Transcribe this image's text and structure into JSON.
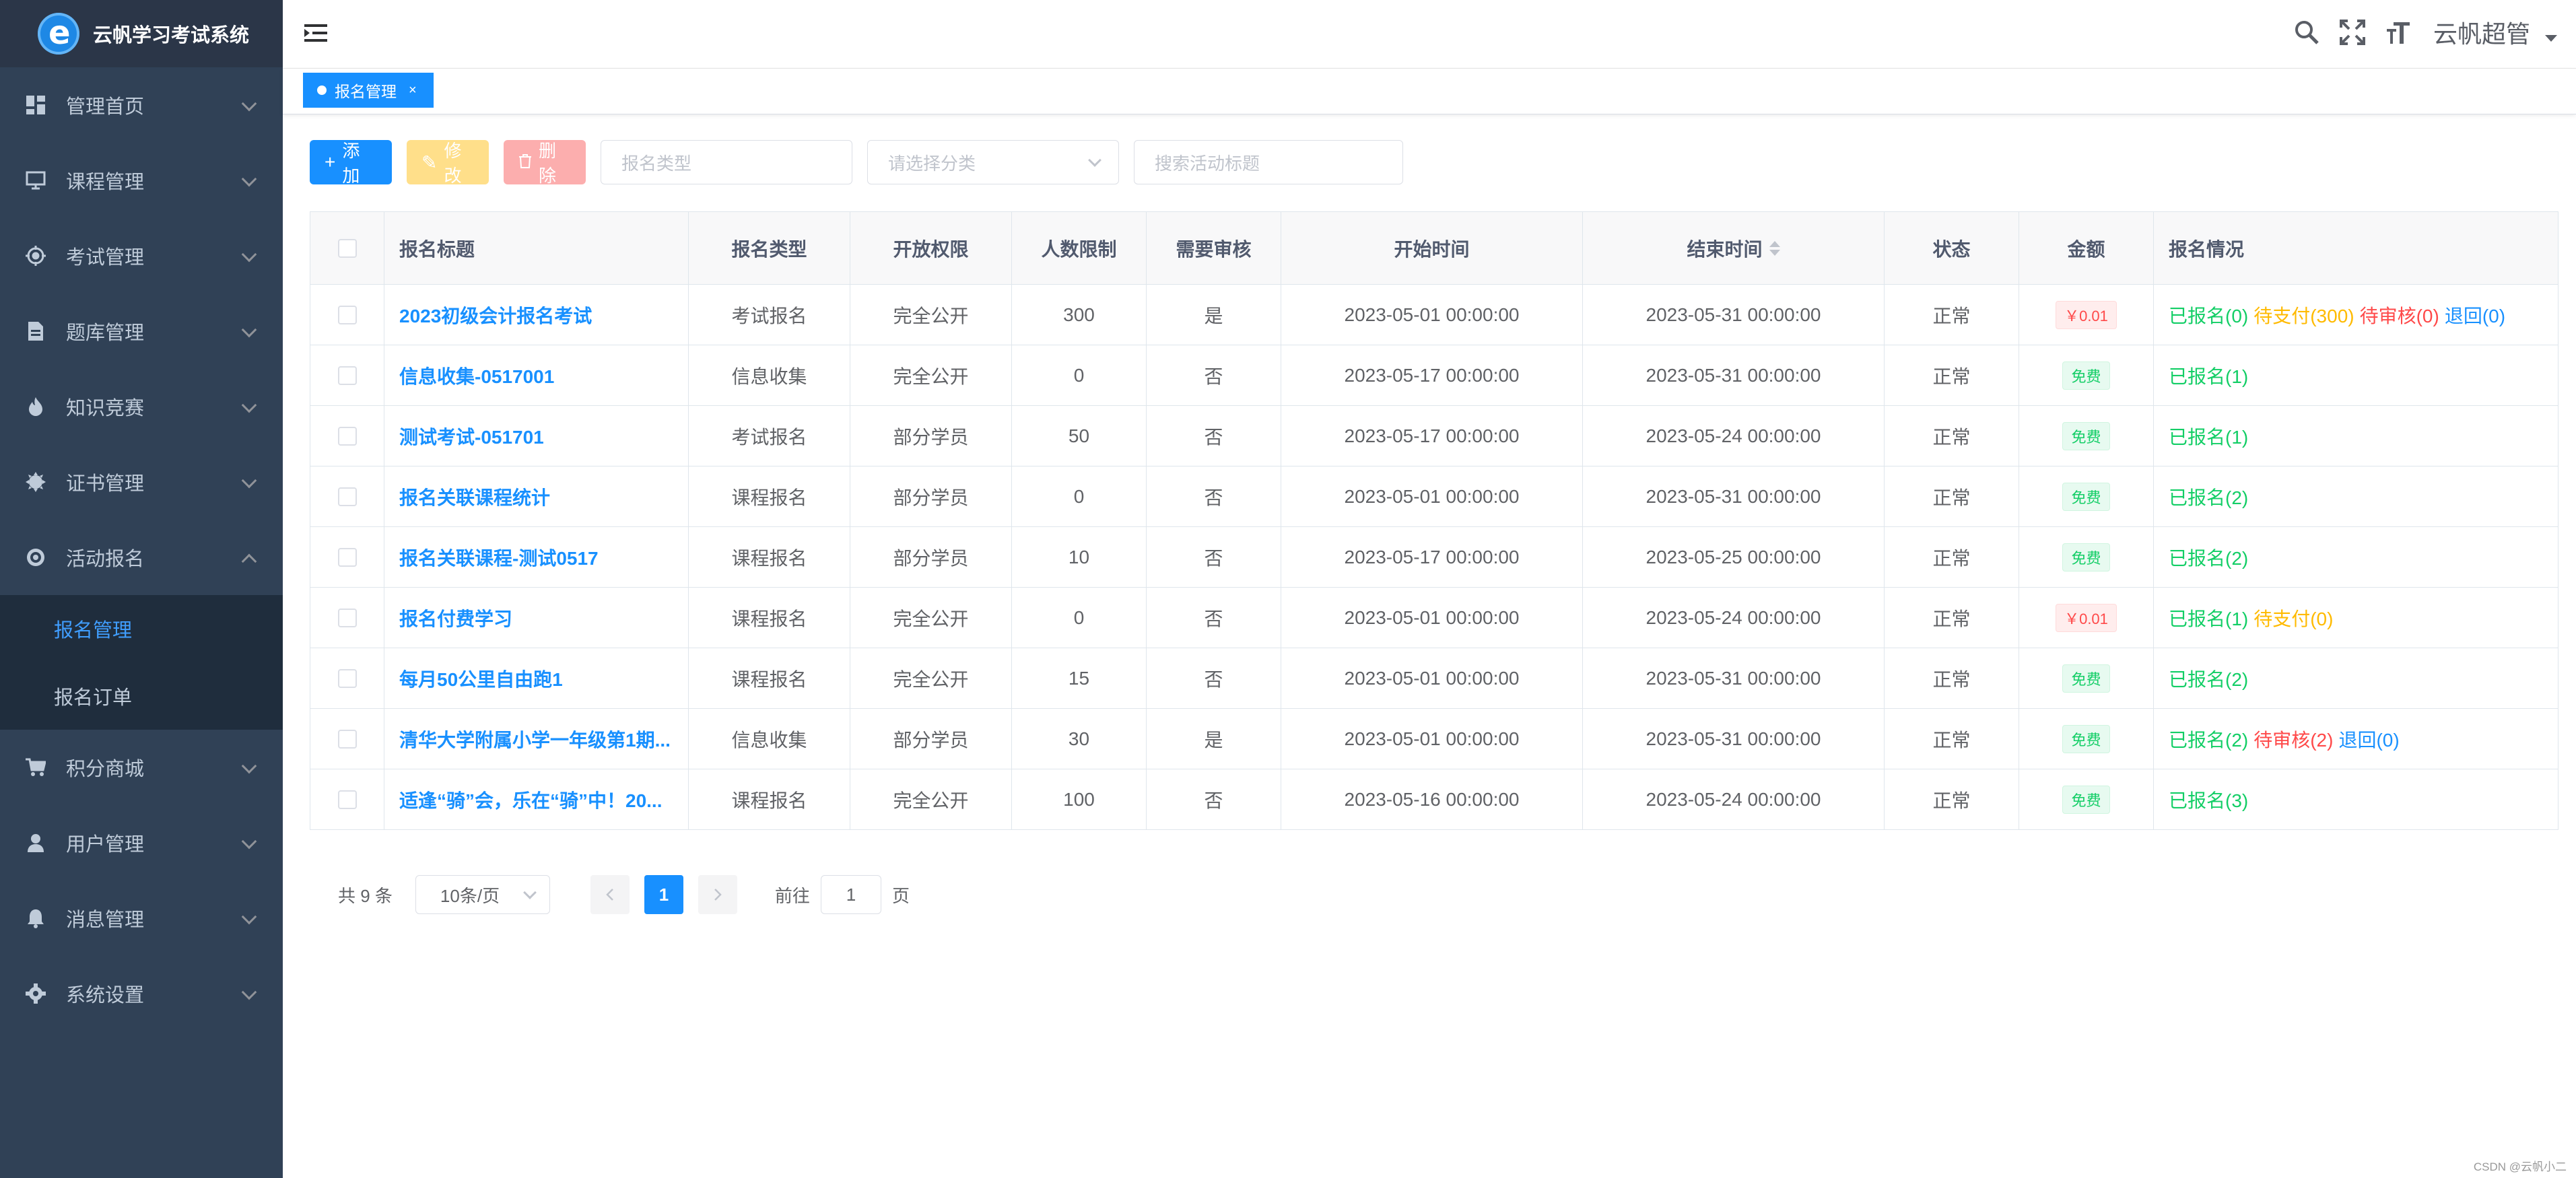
{
  "app": {
    "title": "云帆学习考试系统"
  },
  "sidebar": {
    "items": [
      {
        "label": "管理首页",
        "icon": "dashboard-icon"
      },
      {
        "label": "课程管理",
        "icon": "monitor-icon"
      },
      {
        "label": "考试管理",
        "icon": "target-icon"
      },
      {
        "label": "题库管理",
        "icon": "document-icon"
      },
      {
        "label": "知识竞赛",
        "icon": "fire-icon"
      },
      {
        "label": "证书管理",
        "icon": "badge-icon"
      },
      {
        "label": "活动报名",
        "icon": "record-icon",
        "expanded": true,
        "children": [
          {
            "label": "报名管理",
            "active": true
          },
          {
            "label": "报名订单"
          }
        ]
      },
      {
        "label": "积分商城",
        "icon": "cart-icon"
      },
      {
        "label": "用户管理",
        "icon": "user-icon"
      },
      {
        "label": "消息管理",
        "icon": "bell-icon"
      },
      {
        "label": "系统设置",
        "icon": "gear-icon"
      }
    ]
  },
  "header": {
    "username": "云帆超管"
  },
  "tags": [
    {
      "label": "报名管理",
      "close": "×"
    }
  ],
  "toolbar": {
    "add_label": "添加",
    "edit_label": "修改",
    "delete_label": "删除",
    "type_placeholder": "报名类型",
    "category_placeholder": "请选择分类",
    "search_placeholder": "搜索活动标题"
  },
  "table": {
    "columns": [
      "报名标题",
      "报名类型",
      "开放权限",
      "人数限制",
      "需要审核",
      "开始时间",
      "结束时间",
      "状态",
      "金额",
      "报名情况"
    ],
    "rows": [
      {
        "title": "2023初级会计报名考试",
        "type": "考试报名",
        "permission": "完全公开",
        "limit": "300",
        "audit": "是",
        "start": "2023-05-01 00:00:00",
        "end": "2023-05-31 00:00:00",
        "status": "正常",
        "amount": "￥0.01",
        "amount_kind": "paid",
        "situation": [
          {
            "text": "已报名(0)",
            "color": "green"
          },
          {
            "text": "待支付(300)",
            "color": "orange"
          },
          {
            "text": "待审核(0)",
            "color": "red"
          },
          {
            "text": "退回(0)",
            "color": "blue"
          }
        ]
      },
      {
        "title": "信息收集-0517001",
        "type": "信息收集",
        "permission": "完全公开",
        "limit": "0",
        "audit": "否",
        "start": "2023-05-17 00:00:00",
        "end": "2023-05-31 00:00:00",
        "status": "正常",
        "amount": "免费",
        "amount_kind": "free",
        "situation": [
          {
            "text": "已报名(1)",
            "color": "green"
          }
        ]
      },
      {
        "title": "测试考试-051701",
        "type": "考试报名",
        "permission": "部分学员",
        "limit": "50",
        "audit": "否",
        "start": "2023-05-17 00:00:00",
        "end": "2023-05-24 00:00:00",
        "status": "正常",
        "amount": "免费",
        "amount_kind": "free",
        "situation": [
          {
            "text": "已报名(1)",
            "color": "green"
          }
        ]
      },
      {
        "title": "报名关联课程统计",
        "type": "课程报名",
        "permission": "部分学员",
        "limit": "0",
        "audit": "否",
        "start": "2023-05-01 00:00:00",
        "end": "2023-05-31 00:00:00",
        "status": "正常",
        "amount": "免费",
        "amount_kind": "free",
        "situation": [
          {
            "text": "已报名(2)",
            "color": "green"
          }
        ]
      },
      {
        "title": "报名关联课程-测试0517",
        "type": "课程报名",
        "permission": "部分学员",
        "limit": "10",
        "audit": "否",
        "start": "2023-05-17 00:00:00",
        "end": "2023-05-25 00:00:00",
        "status": "正常",
        "amount": "免费",
        "amount_kind": "free",
        "situation": [
          {
            "text": "已报名(2)",
            "color": "green"
          }
        ]
      },
      {
        "title": "报名付费学习",
        "type": "课程报名",
        "permission": "完全公开",
        "limit": "0",
        "audit": "否",
        "start": "2023-05-01 00:00:00",
        "end": "2023-05-24 00:00:00",
        "status": "正常",
        "amount": "￥0.01",
        "amount_kind": "paid",
        "situation": [
          {
            "text": "已报名(1)",
            "color": "green"
          },
          {
            "text": "待支付(0)",
            "color": "orange"
          }
        ]
      },
      {
        "title": "每月50公里自由跑1",
        "type": "课程报名",
        "permission": "完全公开",
        "limit": "15",
        "audit": "否",
        "start": "2023-05-01 00:00:00",
        "end": "2023-05-31 00:00:00",
        "status": "正常",
        "amount": "免费",
        "amount_kind": "free",
        "situation": [
          {
            "text": "已报名(2)",
            "color": "green"
          }
        ]
      },
      {
        "title": "清华大学附属小学一年级第1期...",
        "type": "信息收集",
        "permission": "部分学员",
        "limit": "30",
        "audit": "是",
        "start": "2023-05-01 00:00:00",
        "end": "2023-05-31 00:00:00",
        "status": "正常",
        "amount": "免费",
        "amount_kind": "free",
        "situation": [
          {
            "text": "已报名(2)",
            "color": "green"
          },
          {
            "text": "待审核(2)",
            "color": "red"
          },
          {
            "text": "退回(0)",
            "color": "blue"
          }
        ]
      },
      {
        "title": "适逢“骑”会，乐在“骑”中！20...",
        "type": "课程报名",
        "permission": "完全公开",
        "limit": "100",
        "audit": "否",
        "start": "2023-05-16 00:00:00",
        "end": "2023-05-24 00:00:00",
        "status": "正常",
        "amount": "免费",
        "amount_kind": "free",
        "situation": [
          {
            "text": "已报名(3)",
            "color": "green"
          }
        ]
      }
    ]
  },
  "pagination": {
    "total_text": "共 9 条",
    "page_size": "10条/页",
    "current_page": "1",
    "goto_prefix": "前往",
    "goto_value": "1",
    "goto_suffix": "页"
  },
  "watermark": "CSDN @云帆小二",
  "colors": {
    "sidebar_bg": "#304156",
    "primary": "#1890ff",
    "success": "#13ce66",
    "warning": "#ffba00",
    "danger": "#ff4949"
  }
}
